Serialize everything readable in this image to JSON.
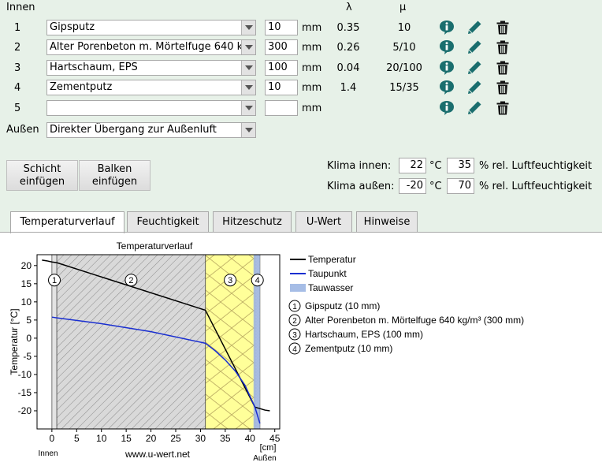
{
  "header": {
    "inside": "Innen",
    "lambda": "λ",
    "mu": "μ",
    "outside": "Außen"
  },
  "layers": [
    {
      "num": "1",
      "material": "Gipsputz",
      "thickness": "10",
      "unit": "mm",
      "lambda": "0.35",
      "mu": "10"
    },
    {
      "num": "2",
      "material": "Alter Porenbeton m. Mörtelfuge 640 kg/m³",
      "thickness": "300",
      "unit": "mm",
      "lambda": "0.26",
      "mu": "5/10"
    },
    {
      "num": "3",
      "material": "Hartschaum, EPS",
      "thickness": "100",
      "unit": "mm",
      "lambda": "0.04",
      "mu": "20/100"
    },
    {
      "num": "4",
      "material": "Zementputz",
      "thickness": "10",
      "unit": "mm",
      "lambda": "1.4",
      "mu": "15/35"
    },
    {
      "num": "5",
      "material": "",
      "thickness": "",
      "unit": "mm",
      "lambda": "",
      "mu": ""
    }
  ],
  "outside_transition": "Direkter Übergang zur Außenluft",
  "buttons": {
    "insert_layer": [
      "Schicht",
      "einfügen"
    ],
    "insert_beam": [
      "Balken",
      "einfügen"
    ]
  },
  "climate": {
    "inside_label": "Klima innen:",
    "inside_temp": "22",
    "inside_rh": "35",
    "outside_label": "Klima außen:",
    "outside_temp": "-20",
    "outside_rh": "70",
    "temp_unit": "°C",
    "rh_unit": "% rel. Luftfeuchtigkeit"
  },
  "tabs": [
    "Temperaturverlauf",
    "Feuchtigkeit",
    "Hitzeschutz",
    "U-Wert",
    "Hinweise"
  ],
  "active_tab": "Temperaturverlauf",
  "colors": {
    "panel_bg": "#e7f1e8",
    "icon_teal": "#1a6e6e",
    "temp_line": "#000000",
    "dew_line": "#1a2fd0",
    "condensate": "#a6bde6",
    "insulation": "#ffff99"
  },
  "chart_data": {
    "type": "line",
    "title": "Temperaturverlauf",
    "xlabel": "[cm]",
    "ylabel": "Temperatur [°C]",
    "x_left_label": "Innen",
    "x_right_label": "Außen",
    "watermark": "www.u-wert.net",
    "xlim": [
      -3,
      46
    ],
    "ylim": [
      -25,
      23
    ],
    "xticks": [
      0,
      5,
      10,
      15,
      20,
      25,
      30,
      35,
      40,
      45
    ],
    "yticks": [
      -20,
      -15,
      -10,
      -5,
      0,
      5,
      10,
      15,
      20
    ],
    "layer_bounds": [
      0,
      1,
      31,
      41,
      42
    ],
    "layer_numbers": [
      "1",
      "2",
      "3",
      "4"
    ],
    "condensate_zone": [
      40.7,
      42
    ],
    "series": [
      {
        "name": "Temperatur",
        "x": [
          -2,
          -1,
          0,
          1,
          31,
          41,
          42,
          43,
          44
        ],
        "y": [
          21.5,
          21.3,
          21.0,
          20.8,
          7.7,
          -19.0,
          -19.4,
          -19.8,
          -20.0
        ]
      },
      {
        "name": "Taupunkt",
        "x": [
          0,
          1,
          10,
          20,
          31,
          33,
          35,
          37,
          39,
          41,
          42
        ],
        "y": [
          5.8,
          5.6,
          4.0,
          1.8,
          -1.4,
          -3.5,
          -6.0,
          -9.0,
          -13.0,
          -19.0,
          -23.5
        ]
      }
    ],
    "legend": [
      {
        "name": "Temperatur"
      },
      {
        "name": "Taupunkt"
      },
      {
        "name": "Tauwasser"
      }
    ],
    "layer_legend": [
      {
        "num": "1",
        "text": "Gipsputz (10 mm)"
      },
      {
        "num": "2",
        "text": "Alter Porenbeton m. Mörtelfuge 640 kg/m³ (300 mm)"
      },
      {
        "num": "3",
        "text": "Hartschaum, EPS (100 mm)"
      },
      {
        "num": "4",
        "text": "Zementputz (10 mm)"
      }
    ]
  }
}
